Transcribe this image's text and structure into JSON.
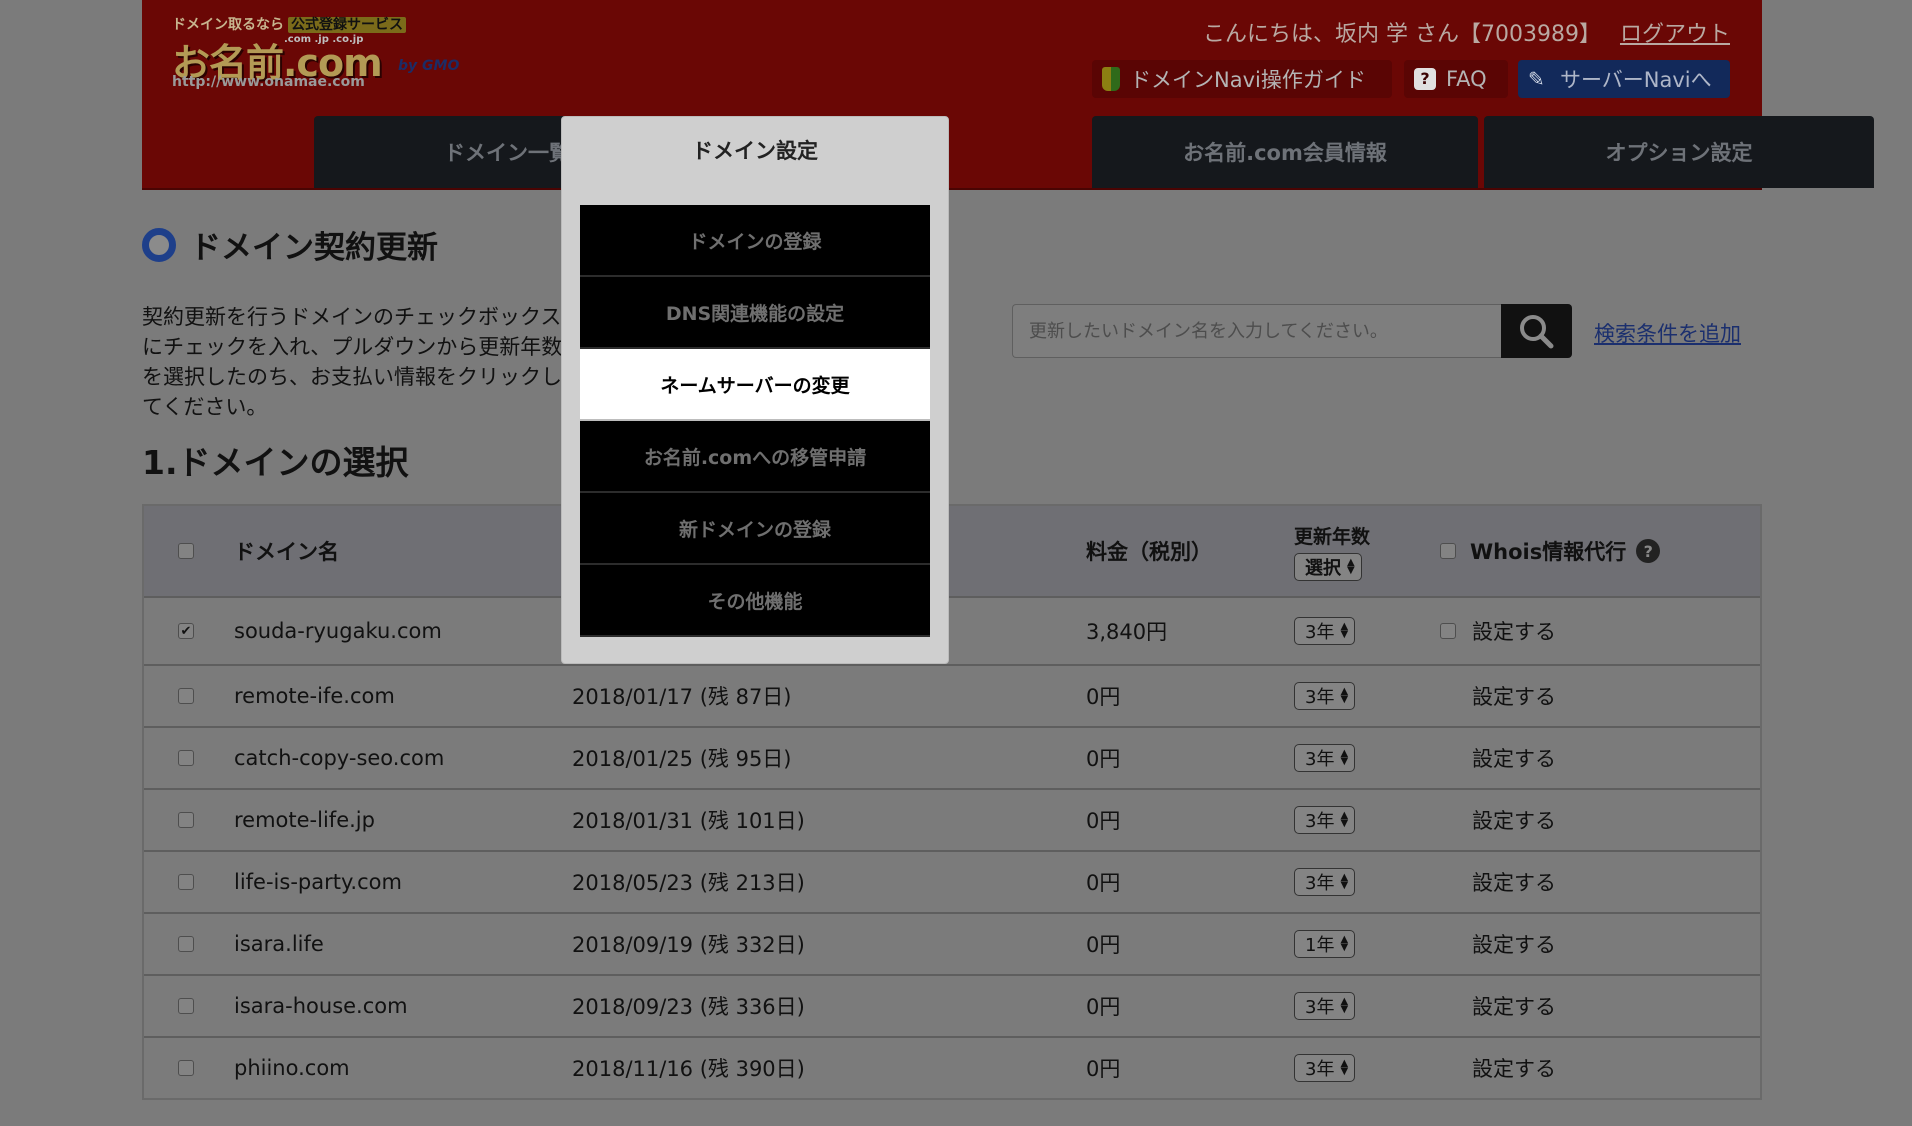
{
  "header": {
    "logo_tag": "ドメイン取るなら",
    "logo_tag_box": "公式登録サービス",
    "logo_brand": "お名前.com",
    "logo_tlds": ".com .jp .co.jp",
    "logo_url": "http://www.onamae.com",
    "logo_by": "by GMO",
    "greeting": "こんにちは、坂内 学 さん【7003989】",
    "logout": "ログアウト",
    "buttons": {
      "guide": "ドメインNavi操作ガイド",
      "faq": "FAQ",
      "server": "サーバーNaviへ"
    }
  },
  "tabs": [
    {
      "label": "ドメイン一覧"
    },
    {
      "label": "ドメイン設定"
    },
    {
      "label": "お名前.com会員情報"
    },
    {
      "label": "オプション設定"
    }
  ],
  "dropdown": {
    "items": [
      {
        "label": "ドメインの登録"
      },
      {
        "label": "DNS関連機能の設定"
      },
      {
        "label": "ネームサーバーの変更",
        "active": true
      },
      {
        "label": "お名前.comへの移管申請"
      },
      {
        "label": "新ドメインの登録"
      },
      {
        "label": "その他機能"
      }
    ]
  },
  "main": {
    "title": "ドメイン契約更新",
    "description": "契約更新を行うドメインのチェックボックスにチェックを入れ、プルダウンから更新年数を選択したのち、お支払い情報をクリックしてください。",
    "search_placeholder": "更新したいドメイン名を入力してください。",
    "search_link": "検索条件を追加",
    "step_title": "1.ドメインの選択"
  },
  "table": {
    "headers": {
      "domain": "ドメイン名",
      "fee": "料金（税別）",
      "years": "更新年数",
      "years_select": "選択",
      "whois": "Whois情報代行",
      "whois_help": "?"
    },
    "rows": [
      {
        "checked": true,
        "domain": "souda-ryugaku.com",
        "date": "",
        "fee": "3,840円",
        "years": "3年",
        "setting": "設定する",
        "whois_checkbox": true
      },
      {
        "checked": false,
        "domain": "remote-ife.com",
        "date": "2018/01/17 (残 87日)",
        "fee": "0円",
        "years": "3年",
        "setting": "設定する",
        "whois_checkbox": false
      },
      {
        "checked": false,
        "domain": "catch-copy-seo.com",
        "date": "2018/01/25 (残 95日)",
        "fee": "0円",
        "years": "3年",
        "setting": "設定する",
        "whois_checkbox": false
      },
      {
        "checked": false,
        "domain": "remote-life.jp",
        "date": "2018/01/31 (残 101日)",
        "fee": "0円",
        "years": "3年",
        "setting": "設定する",
        "whois_checkbox": false
      },
      {
        "checked": false,
        "domain": "life-is-party.com",
        "date": "2018/05/23 (残 213日)",
        "fee": "0円",
        "years": "3年",
        "setting": "設定する",
        "whois_checkbox": false
      },
      {
        "checked": false,
        "domain": "isara.life",
        "date": "2018/09/19 (残 332日)",
        "fee": "0円",
        "years": "1年",
        "setting": "設定する",
        "whois_checkbox": false
      },
      {
        "checked": false,
        "domain": "isara-house.com",
        "date": "2018/09/23 (残 336日)",
        "fee": "0円",
        "years": "3年",
        "setting": "設定する",
        "whois_checkbox": false
      },
      {
        "checked": false,
        "domain": "phiino.com",
        "date": "2018/11/16 (残 390日)",
        "fee": "0円",
        "years": "3年",
        "setting": "設定する",
        "whois_checkbox": false
      }
    ]
  }
}
